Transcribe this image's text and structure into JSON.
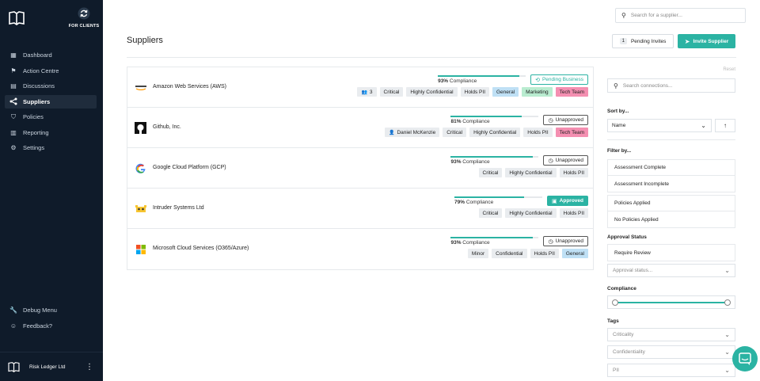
{
  "sidebar": {
    "client_switch_label": "FOR CLIENTS",
    "nav": [
      {
        "label": "Dashboard",
        "icon": "dashboard-icon"
      },
      {
        "label": "Action Centre",
        "icon": "flag-icon"
      },
      {
        "label": "Discussions",
        "icon": "discussions-icon"
      },
      {
        "label": "Suppliers",
        "icon": "share-icon",
        "active": true
      },
      {
        "label": "Policies",
        "icon": "shield-icon"
      },
      {
        "label": "Reporting",
        "icon": "chart-icon"
      },
      {
        "label": "Settings",
        "icon": "gear-icon"
      }
    ],
    "bottom": [
      {
        "label": "Debug Menu",
        "icon": "wrench-icon"
      },
      {
        "label": "Feedback?",
        "icon": "smile-icon"
      }
    ],
    "account_name": "Risk Ledger Ltd"
  },
  "header": {
    "search_placeholder": "Search for a supplier...",
    "title": "Suppliers",
    "pending_count": "1",
    "pending_label": "Pending Invites",
    "invite_label": "Invite Supplier"
  },
  "suppliers": [
    {
      "name": "Amazon Web Services (AWS)",
      "compliance_pct": 93,
      "compliance_value": "93%",
      "compliance_label": "Compliance",
      "status": "Pending Business",
      "status_type": "pending",
      "tags": [
        {
          "text": "3",
          "kind": "users"
        },
        {
          "text": "Critical"
        },
        {
          "text": "Highly Confidential"
        },
        {
          "text": "Holds PII"
        },
        {
          "text": "General",
          "kind": "general"
        },
        {
          "text": "Marketing",
          "kind": "marketing"
        },
        {
          "text": "Tech Team",
          "kind": "tech"
        }
      ]
    },
    {
      "name": "Github, Inc.",
      "compliance_pct": 81,
      "compliance_value": "81%",
      "compliance_label": "Compliance",
      "status": "Unapproved",
      "status_type": "unapproved",
      "tags": [
        {
          "text": "Daniel McKenzie",
          "kind": "user"
        },
        {
          "text": "Critical"
        },
        {
          "text": "Highly Confidential"
        },
        {
          "text": "Holds PII"
        },
        {
          "text": "Tech Team",
          "kind": "tech"
        }
      ]
    },
    {
      "name": "Google Cloud Platform (GCP)",
      "compliance_pct": 93,
      "compliance_value": "93%",
      "compliance_label": "Compliance",
      "status": "Unapproved",
      "status_type": "unapproved",
      "tags": [
        {
          "text": "Critical"
        },
        {
          "text": "Highly Confidential"
        },
        {
          "text": "Holds PII"
        }
      ]
    },
    {
      "name": "Intruder Systems Ltd",
      "compliance_pct": 79,
      "compliance_value": "79%",
      "compliance_label": "Compliance",
      "status": "Approved",
      "status_type": "approved",
      "tags": [
        {
          "text": "Critical"
        },
        {
          "text": "Highly Confidential"
        },
        {
          "text": "Holds PII"
        }
      ]
    },
    {
      "name": "Microsoft Cloud Services (O365/Azure)",
      "compliance_pct": 93,
      "compliance_value": "93%",
      "compliance_label": "Compliance",
      "status": "Unapproved",
      "status_type": "unapproved",
      "tags": [
        {
          "text": "Minor"
        },
        {
          "text": "Confidential"
        },
        {
          "text": "Holds PII"
        },
        {
          "text": "General",
          "kind": "general"
        }
      ]
    }
  ],
  "filters": {
    "reset_label": "Reset",
    "search_placeholder": "Search connections...",
    "sort_label": "Sort by...",
    "sort_value": "Name",
    "filter_label": "Filter by...",
    "assessment_options": [
      "Assessment Complete",
      "Assessment Incomplete"
    ],
    "policy_options": [
      "Policies Applied",
      "No Policies Applied"
    ],
    "approval_label": "Approval Status",
    "approval_option": "Require Review",
    "approval_placeholder": "Approval status...",
    "compliance_label": "Compliance",
    "compliance_range": [
      0,
      100
    ],
    "tags_label": "Tags",
    "tag_dropdowns": [
      "Criticality",
      "Confidentiality",
      "PII"
    ]
  },
  "colors": {
    "accent": "#2bb3a3",
    "sidebar": "#0f1b2a",
    "tech_tag": "#f48fb1",
    "general_tag": "#bfe0f5",
    "marketing_tag": "#b9ecd0"
  }
}
